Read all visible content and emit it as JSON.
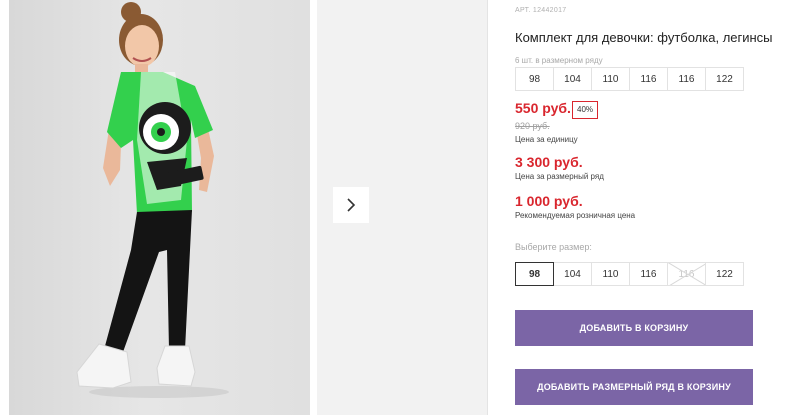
{
  "product": {
    "sku": "АРТ. 12442017",
    "title": "Комплект для девочки: футболка, легинсы"
  },
  "size_range": {
    "note": "6 шт. в размерном ряду",
    "sizes": [
      "98",
      "104",
      "110",
      "116",
      "116",
      "122"
    ]
  },
  "prices": {
    "main": "550 руб.",
    "discount": "40%",
    "old": "920 руб.",
    "unit_label": "Цена за единицу",
    "range": "3 300 руб.",
    "range_label": "Цена за размерный ряд",
    "rrp": "1 000 руб.",
    "rrp_label": "Рекомендуемая розничная цена"
  },
  "size_select": {
    "label": "Выберите размер:",
    "options": [
      {
        "label": "98",
        "state": "selected"
      },
      {
        "label": "104",
        "state": "available"
      },
      {
        "label": "110",
        "state": "available"
      },
      {
        "label": "116",
        "state": "available"
      },
      {
        "label": "116",
        "state": "disabled"
      },
      {
        "label": "122",
        "state": "available"
      }
    ]
  },
  "buttons": {
    "add_to_cart": "ДОБАВИТЬ В КОРЗИНУ",
    "add_range_to_cart": "ДОБАВИТЬ РАЗМЕРНЫЙ РЯД В КОРЗИНУ"
  },
  "colors": {
    "accent": "#7b65a6",
    "price": "#d9262e"
  },
  "icons": {
    "gallery_next": "chevron-right-icon"
  }
}
